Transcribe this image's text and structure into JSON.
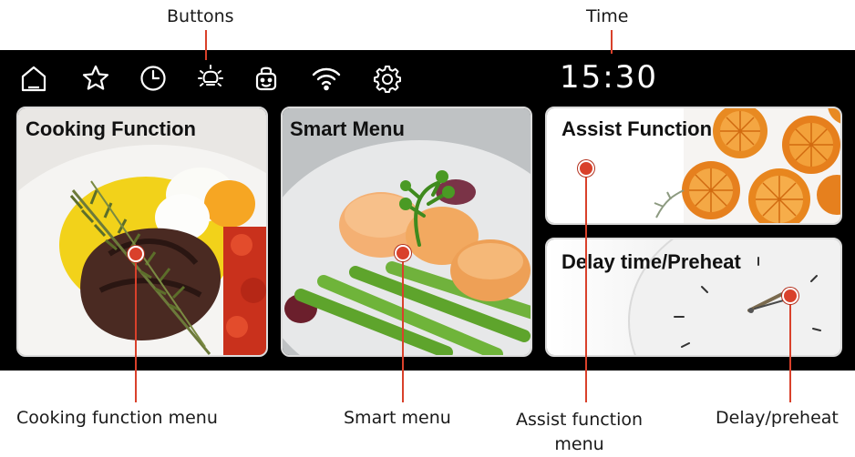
{
  "callouts": {
    "buttons": "Buttons",
    "time": "Time",
    "cooking": "Cooking function menu",
    "smart": "Smart menu",
    "assist_line1": "Assist function",
    "assist_line2": "menu",
    "delay": "Delay/preheat"
  },
  "status_bar": {
    "time": "15:30",
    "icons": [
      "home-icon",
      "star-icon",
      "clock-icon",
      "light-bulb-icon",
      "robot-icon",
      "wifi-icon",
      "gear-icon"
    ]
  },
  "cards": {
    "cooking": {
      "title": "Cooking Function"
    },
    "smart": {
      "title": "Smart Menu"
    },
    "assist": {
      "title": "Assist Function"
    },
    "delay": {
      "title": "Delay time/Preheat"
    }
  },
  "colors": {
    "screen_bg": "#000000",
    "callout_line": "#d9412b",
    "card_border": "#dcdcdc"
  }
}
